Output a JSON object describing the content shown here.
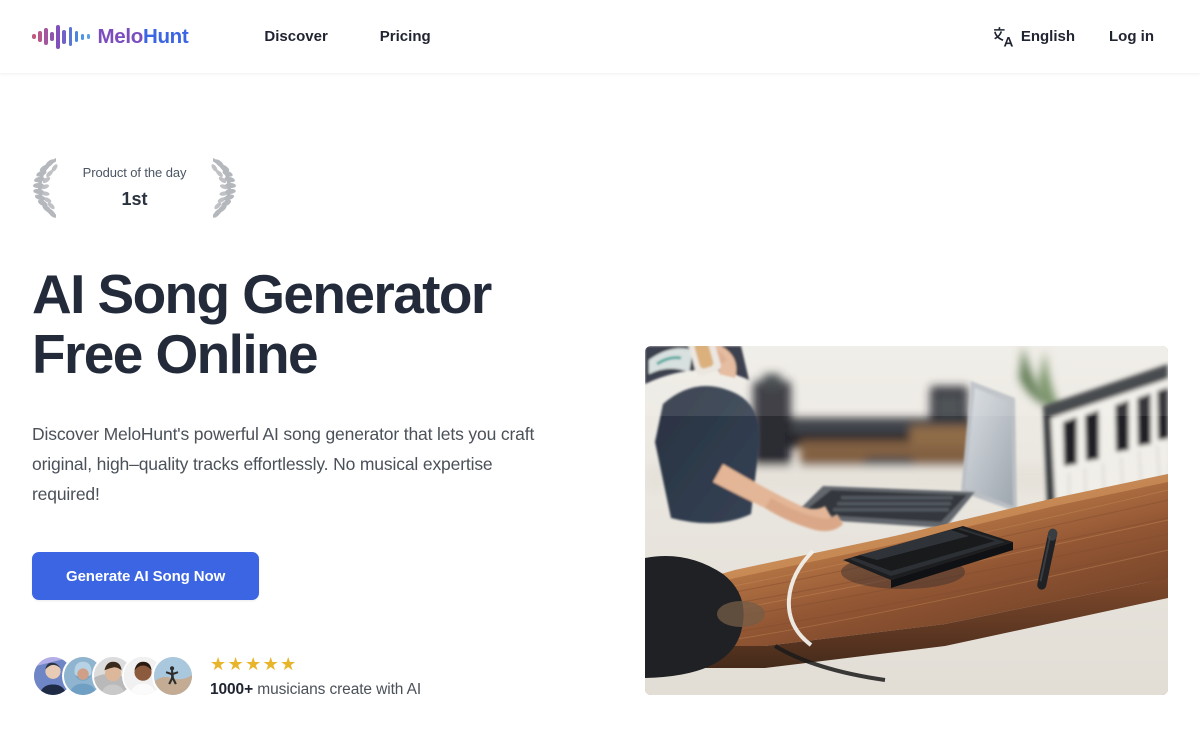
{
  "brand": {
    "name_part1": "Melo",
    "name_part2": "Hunt",
    "logo_icon": "waveform-icon",
    "colors": {
      "melo": "#7c4dbe",
      "hunt": "#3b65e3"
    }
  },
  "header": {
    "nav": [
      {
        "label": "Discover",
        "name": "nav-discover"
      },
      {
        "label": "Pricing",
        "name": "nav-pricing"
      }
    ],
    "language": {
      "label": "English",
      "icon": "translate-icon"
    },
    "login_label": "Log in"
  },
  "hero": {
    "badge": {
      "left_icon": "laurel-left-icon",
      "right_icon": "laurel-right-icon",
      "line1": "Product of the day",
      "line2": "1st"
    },
    "title": "AI Song Generator Free Online",
    "title_line1": "AI Song Generator",
    "title_line2": "Free Online",
    "subtitle": "Discover MeloHunt's powerful AI song generator that lets you craft original, high–quality tracks effortlessly. No musical expertise required!",
    "cta_label": "Generate AI Song Now",
    "cta_color": "#3b65e3",
    "social_proof": {
      "stars": "★★★★★",
      "star_count": 5,
      "star_color": "#e8b429",
      "count": "1000+",
      "text": " musicians create with AI",
      "avatar_count": 5
    },
    "image_alt": "music-producer-at-desk-with-laptop-and-midi-keyboard"
  }
}
